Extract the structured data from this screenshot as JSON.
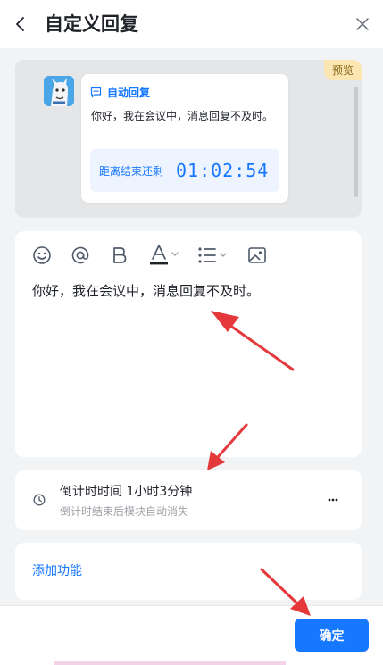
{
  "header": {
    "title": "自定义回复"
  },
  "preview": {
    "tag": "预览",
    "card_title": "自动回复",
    "message": "你好，我在会议中，消息回复不及时。",
    "countdown_label": "距离结束还剩",
    "countdown_time": "01:02:54"
  },
  "editor": {
    "toolbar": [
      "emoji-icon",
      "mention-icon",
      "bold-icon",
      "text-color-icon",
      "list-icon",
      "image-icon"
    ],
    "content": "你好，我在会议中，消息回复不及时。"
  },
  "timer": {
    "title": "倒计时时间 1小时3分钟",
    "subtitle": "倒计时结束后模块自动消失"
  },
  "add_feature": {
    "label": "添加功能"
  },
  "footer": {
    "confirm_label": "确定"
  },
  "colors": {
    "accent": "#1677ff",
    "annotation": "#e5383b",
    "tag_bg": "#fbe6b4"
  }
}
